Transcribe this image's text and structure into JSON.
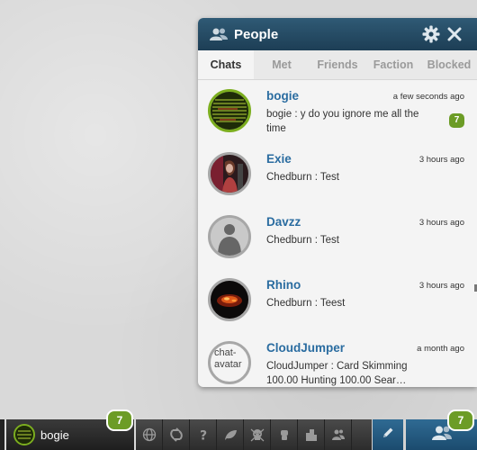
{
  "panel": {
    "title": "People",
    "tabs": [
      "Chats",
      "Met",
      "Friends",
      "Faction",
      "Blocked"
    ],
    "active_tab": "Chats"
  },
  "chats": [
    {
      "name": "bogie",
      "time": "a few seconds ago",
      "message": "bogie : y do you ignore me all the time",
      "unread": "7",
      "online": true
    },
    {
      "name": "Exie",
      "time": "3 hours ago",
      "message": "Chedburn : Test"
    },
    {
      "name": "Davzz",
      "time": "3 hours ago",
      "message": "Chedburn : Test"
    },
    {
      "name": "Rhino",
      "time": "3 hours ago",
      "message": "Chedburn : Teest"
    },
    {
      "name": "CloudJumper",
      "time": "a month ago",
      "message": "CloudJumper : Card Skimming 100.00 Hunting 100.00 Sear…",
      "avatar_alt": "chat-avatar"
    }
  ],
  "bottom_bar": {
    "user_name": "bogie",
    "user_badge": "7",
    "people_badge": "7",
    "tools": [
      "globe-icon",
      "refresh-icon",
      "help-icon",
      "leaf-icon",
      "skull-icon",
      "fist-icon",
      "buildings-icon",
      "people-icon"
    ]
  },
  "colors": {
    "header": "#1d3e55",
    "accent_blue": "#2a6ca0",
    "badge_green": "#6c9c26"
  }
}
